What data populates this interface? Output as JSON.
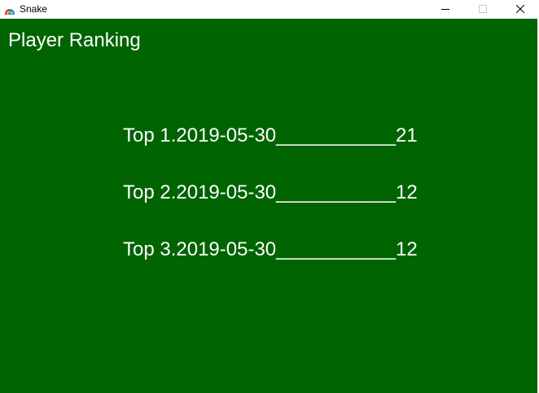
{
  "window": {
    "title": "Snake",
    "icon": "snake-app-icon",
    "controls": [
      "minimize-icon",
      "maximize-icon",
      "close-icon"
    ]
  },
  "colors": {
    "background": "#006400",
    "text": "#ffffff"
  },
  "screen": {
    "heading": "Player Ranking",
    "rankings": [
      {
        "text": "Top 1.2019-05-30___________21"
      },
      {
        "text": "Top 2.2019-05-30___________12"
      },
      {
        "text": "Top 3.2019-05-30___________12"
      }
    ]
  }
}
